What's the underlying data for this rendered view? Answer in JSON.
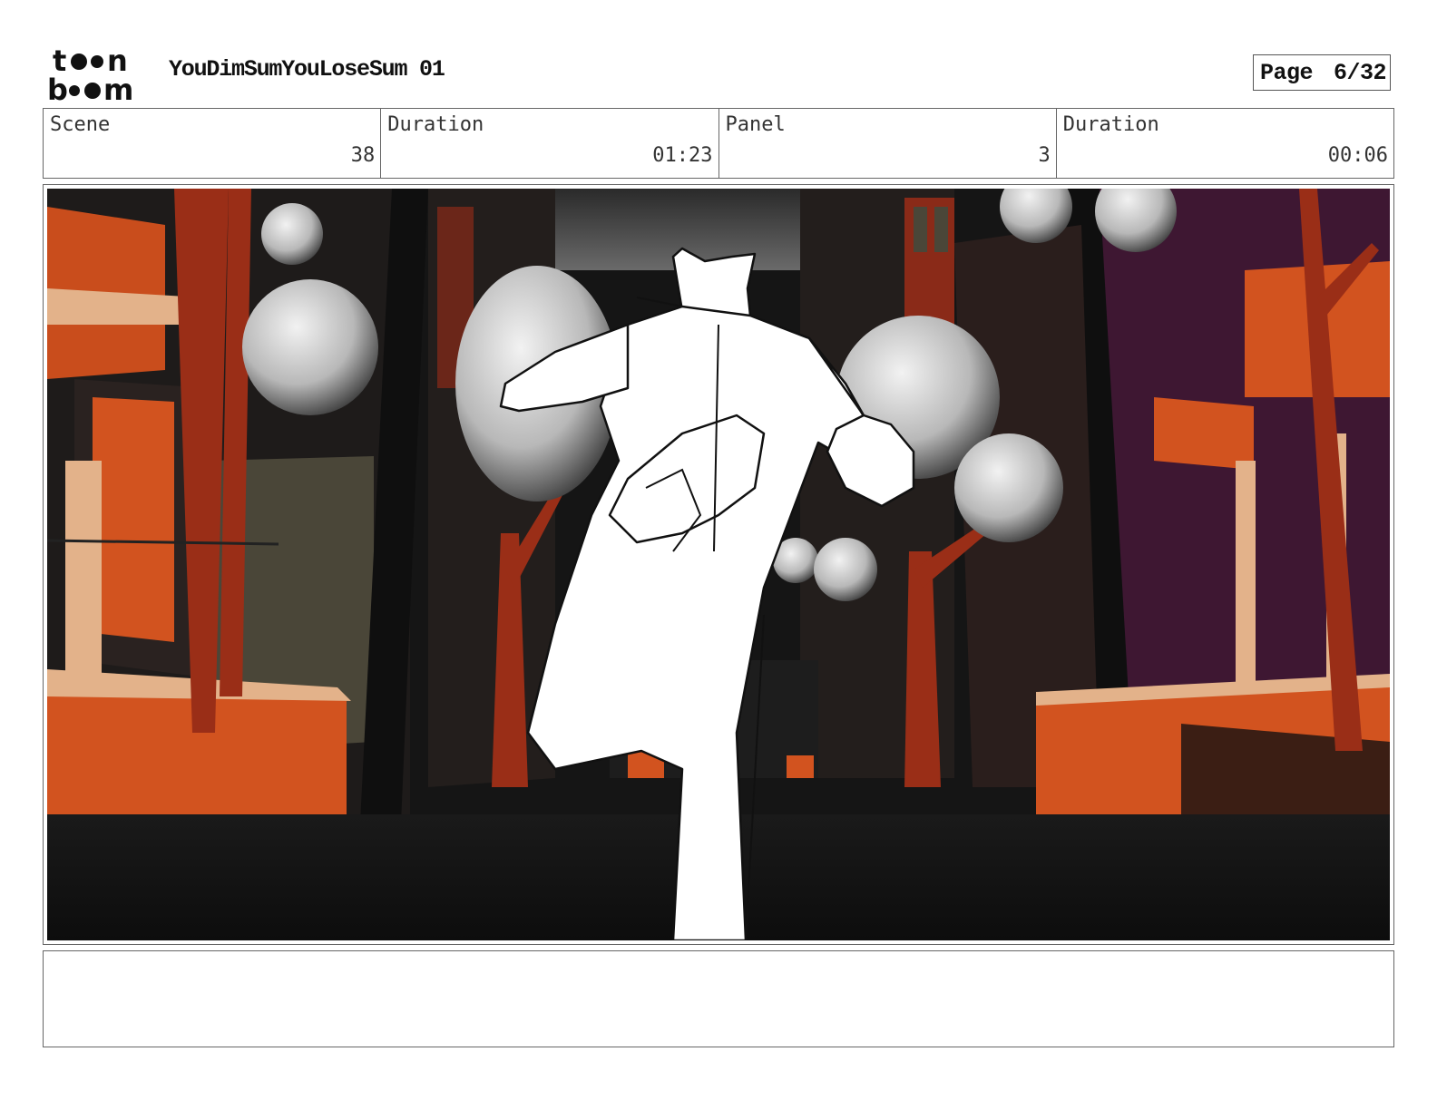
{
  "header": {
    "logo_text": "toon boom",
    "title": "YouDimSumYouLoseSum 01",
    "page_label": "Page",
    "page_value": "6/32"
  },
  "info": {
    "scene_label": "Scene",
    "scene_value": "38",
    "scene_duration_label": "Duration",
    "scene_duration_value": "01:23",
    "panel_label": "Panel",
    "panel_value": "3",
    "panel_duration_label": "Duration",
    "panel_duration_value": "00:06"
  },
  "colors": {
    "orange": "#d2531f",
    "trunk": "#9a2e17",
    "cream": "#e3b28a",
    "purple": "#3e1732",
    "dark": "#141414"
  }
}
